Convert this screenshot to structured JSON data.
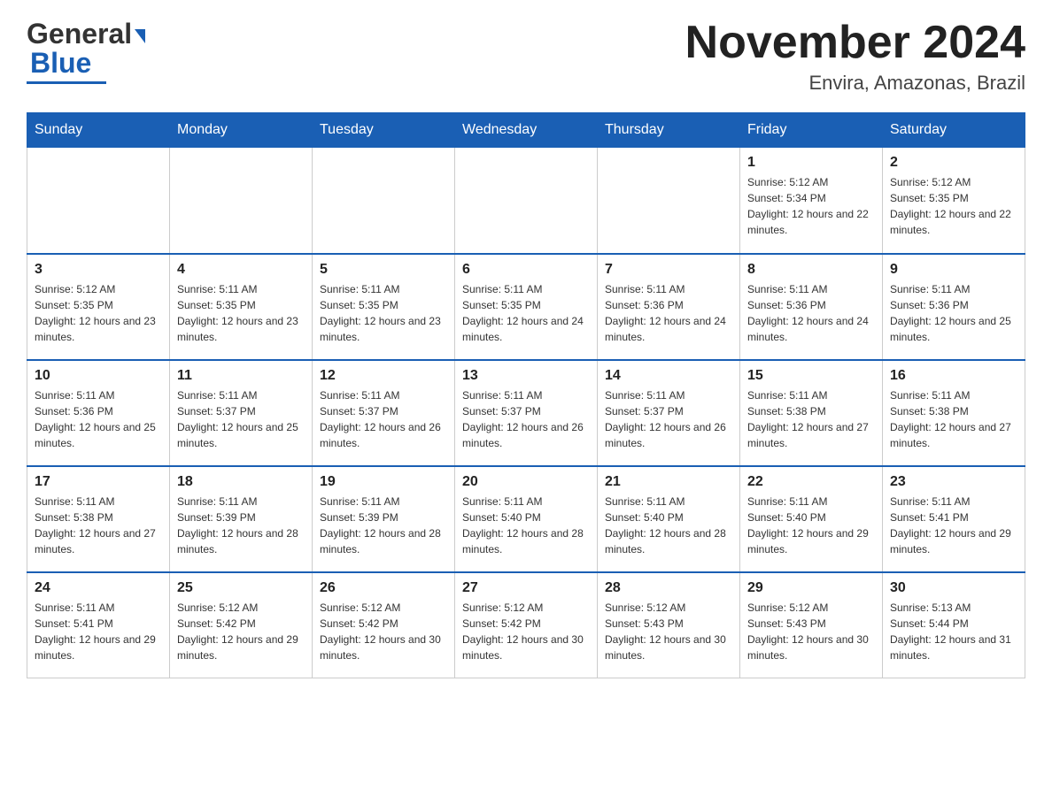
{
  "header": {
    "logo": {
      "text_general": "General",
      "text_blue": "Blue"
    },
    "title": "November 2024",
    "location": "Envira, Amazonas, Brazil"
  },
  "weekdays": [
    "Sunday",
    "Monday",
    "Tuesday",
    "Wednesday",
    "Thursday",
    "Friday",
    "Saturday"
  ],
  "weeks": [
    [
      {
        "day": "",
        "sunrise": "",
        "sunset": "",
        "daylight": ""
      },
      {
        "day": "",
        "sunrise": "",
        "sunset": "",
        "daylight": ""
      },
      {
        "day": "",
        "sunrise": "",
        "sunset": "",
        "daylight": ""
      },
      {
        "day": "",
        "sunrise": "",
        "sunset": "",
        "daylight": ""
      },
      {
        "day": "",
        "sunrise": "",
        "sunset": "",
        "daylight": ""
      },
      {
        "day": "1",
        "sunrise": "Sunrise: 5:12 AM",
        "sunset": "Sunset: 5:34 PM",
        "daylight": "Daylight: 12 hours and 22 minutes."
      },
      {
        "day": "2",
        "sunrise": "Sunrise: 5:12 AM",
        "sunset": "Sunset: 5:35 PM",
        "daylight": "Daylight: 12 hours and 22 minutes."
      }
    ],
    [
      {
        "day": "3",
        "sunrise": "Sunrise: 5:12 AM",
        "sunset": "Sunset: 5:35 PM",
        "daylight": "Daylight: 12 hours and 23 minutes."
      },
      {
        "day": "4",
        "sunrise": "Sunrise: 5:11 AM",
        "sunset": "Sunset: 5:35 PM",
        "daylight": "Daylight: 12 hours and 23 minutes."
      },
      {
        "day": "5",
        "sunrise": "Sunrise: 5:11 AM",
        "sunset": "Sunset: 5:35 PM",
        "daylight": "Daylight: 12 hours and 23 minutes."
      },
      {
        "day": "6",
        "sunrise": "Sunrise: 5:11 AM",
        "sunset": "Sunset: 5:35 PM",
        "daylight": "Daylight: 12 hours and 24 minutes."
      },
      {
        "day": "7",
        "sunrise": "Sunrise: 5:11 AM",
        "sunset": "Sunset: 5:36 PM",
        "daylight": "Daylight: 12 hours and 24 minutes."
      },
      {
        "day": "8",
        "sunrise": "Sunrise: 5:11 AM",
        "sunset": "Sunset: 5:36 PM",
        "daylight": "Daylight: 12 hours and 24 minutes."
      },
      {
        "day": "9",
        "sunrise": "Sunrise: 5:11 AM",
        "sunset": "Sunset: 5:36 PM",
        "daylight": "Daylight: 12 hours and 25 minutes."
      }
    ],
    [
      {
        "day": "10",
        "sunrise": "Sunrise: 5:11 AM",
        "sunset": "Sunset: 5:36 PM",
        "daylight": "Daylight: 12 hours and 25 minutes."
      },
      {
        "day": "11",
        "sunrise": "Sunrise: 5:11 AM",
        "sunset": "Sunset: 5:37 PM",
        "daylight": "Daylight: 12 hours and 25 minutes."
      },
      {
        "day": "12",
        "sunrise": "Sunrise: 5:11 AM",
        "sunset": "Sunset: 5:37 PM",
        "daylight": "Daylight: 12 hours and 26 minutes."
      },
      {
        "day": "13",
        "sunrise": "Sunrise: 5:11 AM",
        "sunset": "Sunset: 5:37 PM",
        "daylight": "Daylight: 12 hours and 26 minutes."
      },
      {
        "day": "14",
        "sunrise": "Sunrise: 5:11 AM",
        "sunset": "Sunset: 5:37 PM",
        "daylight": "Daylight: 12 hours and 26 minutes."
      },
      {
        "day": "15",
        "sunrise": "Sunrise: 5:11 AM",
        "sunset": "Sunset: 5:38 PM",
        "daylight": "Daylight: 12 hours and 27 minutes."
      },
      {
        "day": "16",
        "sunrise": "Sunrise: 5:11 AM",
        "sunset": "Sunset: 5:38 PM",
        "daylight": "Daylight: 12 hours and 27 minutes."
      }
    ],
    [
      {
        "day": "17",
        "sunrise": "Sunrise: 5:11 AM",
        "sunset": "Sunset: 5:38 PM",
        "daylight": "Daylight: 12 hours and 27 minutes."
      },
      {
        "day": "18",
        "sunrise": "Sunrise: 5:11 AM",
        "sunset": "Sunset: 5:39 PM",
        "daylight": "Daylight: 12 hours and 28 minutes."
      },
      {
        "day": "19",
        "sunrise": "Sunrise: 5:11 AM",
        "sunset": "Sunset: 5:39 PM",
        "daylight": "Daylight: 12 hours and 28 minutes."
      },
      {
        "day": "20",
        "sunrise": "Sunrise: 5:11 AM",
        "sunset": "Sunset: 5:40 PM",
        "daylight": "Daylight: 12 hours and 28 minutes."
      },
      {
        "day": "21",
        "sunrise": "Sunrise: 5:11 AM",
        "sunset": "Sunset: 5:40 PM",
        "daylight": "Daylight: 12 hours and 28 minutes."
      },
      {
        "day": "22",
        "sunrise": "Sunrise: 5:11 AM",
        "sunset": "Sunset: 5:40 PM",
        "daylight": "Daylight: 12 hours and 29 minutes."
      },
      {
        "day": "23",
        "sunrise": "Sunrise: 5:11 AM",
        "sunset": "Sunset: 5:41 PM",
        "daylight": "Daylight: 12 hours and 29 minutes."
      }
    ],
    [
      {
        "day": "24",
        "sunrise": "Sunrise: 5:11 AM",
        "sunset": "Sunset: 5:41 PM",
        "daylight": "Daylight: 12 hours and 29 minutes."
      },
      {
        "day": "25",
        "sunrise": "Sunrise: 5:12 AM",
        "sunset": "Sunset: 5:42 PM",
        "daylight": "Daylight: 12 hours and 29 minutes."
      },
      {
        "day": "26",
        "sunrise": "Sunrise: 5:12 AM",
        "sunset": "Sunset: 5:42 PM",
        "daylight": "Daylight: 12 hours and 30 minutes."
      },
      {
        "day": "27",
        "sunrise": "Sunrise: 5:12 AM",
        "sunset": "Sunset: 5:42 PM",
        "daylight": "Daylight: 12 hours and 30 minutes."
      },
      {
        "day": "28",
        "sunrise": "Sunrise: 5:12 AM",
        "sunset": "Sunset: 5:43 PM",
        "daylight": "Daylight: 12 hours and 30 minutes."
      },
      {
        "day": "29",
        "sunrise": "Sunrise: 5:12 AM",
        "sunset": "Sunset: 5:43 PM",
        "daylight": "Daylight: 12 hours and 30 minutes."
      },
      {
        "day": "30",
        "sunrise": "Sunrise: 5:13 AM",
        "sunset": "Sunset: 5:44 PM",
        "daylight": "Daylight: 12 hours and 31 minutes."
      }
    ]
  ]
}
